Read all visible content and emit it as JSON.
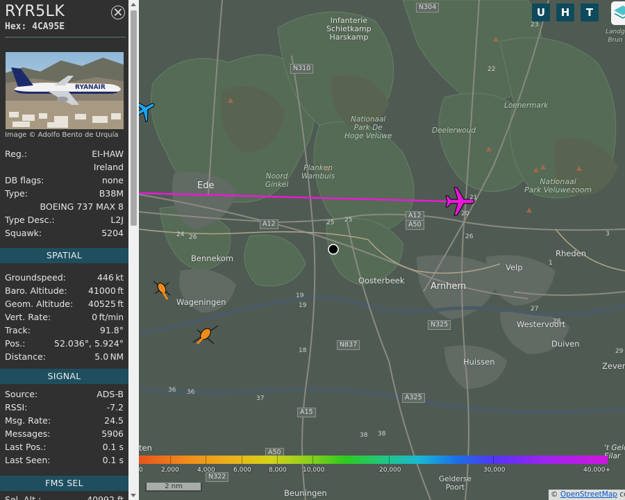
{
  "aircraft": {
    "callsign": "RYR5LK",
    "hex_label": "Hex:",
    "hex": "4CA95E",
    "photo_credit": "Image © Adolfo Bento de Urquía",
    "details": [
      {
        "k": "Reg.:",
        "v": "EI-HAW"
      },
      {
        "k": "",
        "v": "Ireland"
      },
      {
        "k": "DB flags:",
        "v": "none"
      },
      {
        "k": "Type:",
        "v": "B38M"
      },
      {
        "k": "",
        "v": "BOEING 737 MAX 8"
      },
      {
        "k": "Type Desc.:",
        "v": "L2J"
      },
      {
        "k": "Squawk:",
        "v": "5204"
      }
    ]
  },
  "spatial": {
    "title": "SPATIAL",
    "rows": [
      {
        "k": "Groundspeed:",
        "v": "446",
        "u": "kt"
      },
      {
        "k": "Baro. Altitude:",
        "v": "41000",
        "u": "ft"
      },
      {
        "k": "Geom. Altitude:",
        "v": "40525",
        "u": "ft"
      },
      {
        "k": "Vert. Rate:",
        "v": "0",
        "u": "ft/min"
      },
      {
        "k": "Track:",
        "v": "91.8°",
        "u": ""
      },
      {
        "k": "Pos.:",
        "v": "52.036°, 5.924°",
        "u": ""
      },
      {
        "k": "Distance:",
        "v": "5.0",
        "u": "NM"
      }
    ]
  },
  "signal": {
    "title": "SIGNAL",
    "rows": [
      {
        "k": "Source:",
        "v": "ADS-B"
      },
      {
        "k": "RSSI:",
        "v": "-7.2"
      },
      {
        "k": "Msg. Rate:",
        "v": "24.5"
      },
      {
        "k": "Messages:",
        "v": "5906"
      },
      {
        "k": "Last Pos.:",
        "v": "0.1 s"
      },
      {
        "k": "Last Seen:",
        "v": "0.1 s"
      }
    ]
  },
  "fms": {
    "title": "FMS SEL",
    "partial_label": "Sel. Alt.:",
    "partial_value": "40992 ft"
  },
  "map": {
    "buttons": {
      "u": "U",
      "h": "H",
      "t": "T"
    },
    "scale": "2 nm",
    "attribution_prefix": "©",
    "attribution_link": "OpenStreetMap",
    "attribution_suffix": "co",
    "altitude_labels": [
      "0",
      "2,000",
      "4,000",
      "6,000",
      "8,000",
      "10,000",
      "20,000",
      "30,000",
      "40,000+"
    ],
    "places": {
      "infanterie": "Infanterie\nSchietkamp\nHarskamp",
      "nationaal_hv": "Nationaal\nPark De\nHoge Veluwe",
      "deelerwoud": "Deelerwoud",
      "loenermark": "Loenermark",
      "park_veluwezoom": "Nationaal\nPark Veluwezoom",
      "noord_ginkel": "Noord\nGinkel",
      "planken": "Planken\nWambuis",
      "ede": "Ede",
      "bennekom": "Bennekom",
      "wageningen": "Wageningen",
      "oosterbeek": "Oosterbeek",
      "arnhem": "Arnhem",
      "velp": "Velp",
      "rheden": "Rheden",
      "westervoort": "Westervoort",
      "duiven": "Duiven",
      "huissen": "Huissen",
      "zevena": "Zevena",
      "landg": "Landg\nBrun",
      "gelderse": "Gelderse\nPoort",
      "beuningen": "Beuningen",
      "eilar": "'t Geld\nEilar",
      "ten": "ten"
    },
    "roads": {
      "n304": "N304",
      "n310": "N310",
      "a12a": "A12",
      "a12b": "A12",
      "a50": "A50",
      "n325": "N325",
      "n837": "N837",
      "a325": "A325",
      "a15": "A15",
      "a50b": "A50",
      "n322": "N322"
    },
    "junctions": [
      "23",
      "22",
      "21",
      "20",
      "26",
      "25",
      "24",
      "26",
      "19",
      "18",
      "19",
      "28",
      "27",
      "1",
      "36",
      "36",
      "37",
      "38",
      "38",
      "29",
      "3",
      "25"
    ]
  },
  "colors": {
    "sidebar_bg": "#303030",
    "section_bg": "#1f4f5f",
    "map_button_bg": "#0e4a5c",
    "selected_aircraft": "#e81ad7",
    "track_line": "#e81ad7",
    "aircraft_blue": "#1fa3f0",
    "helicopter_orange": "#f08a1a"
  }
}
